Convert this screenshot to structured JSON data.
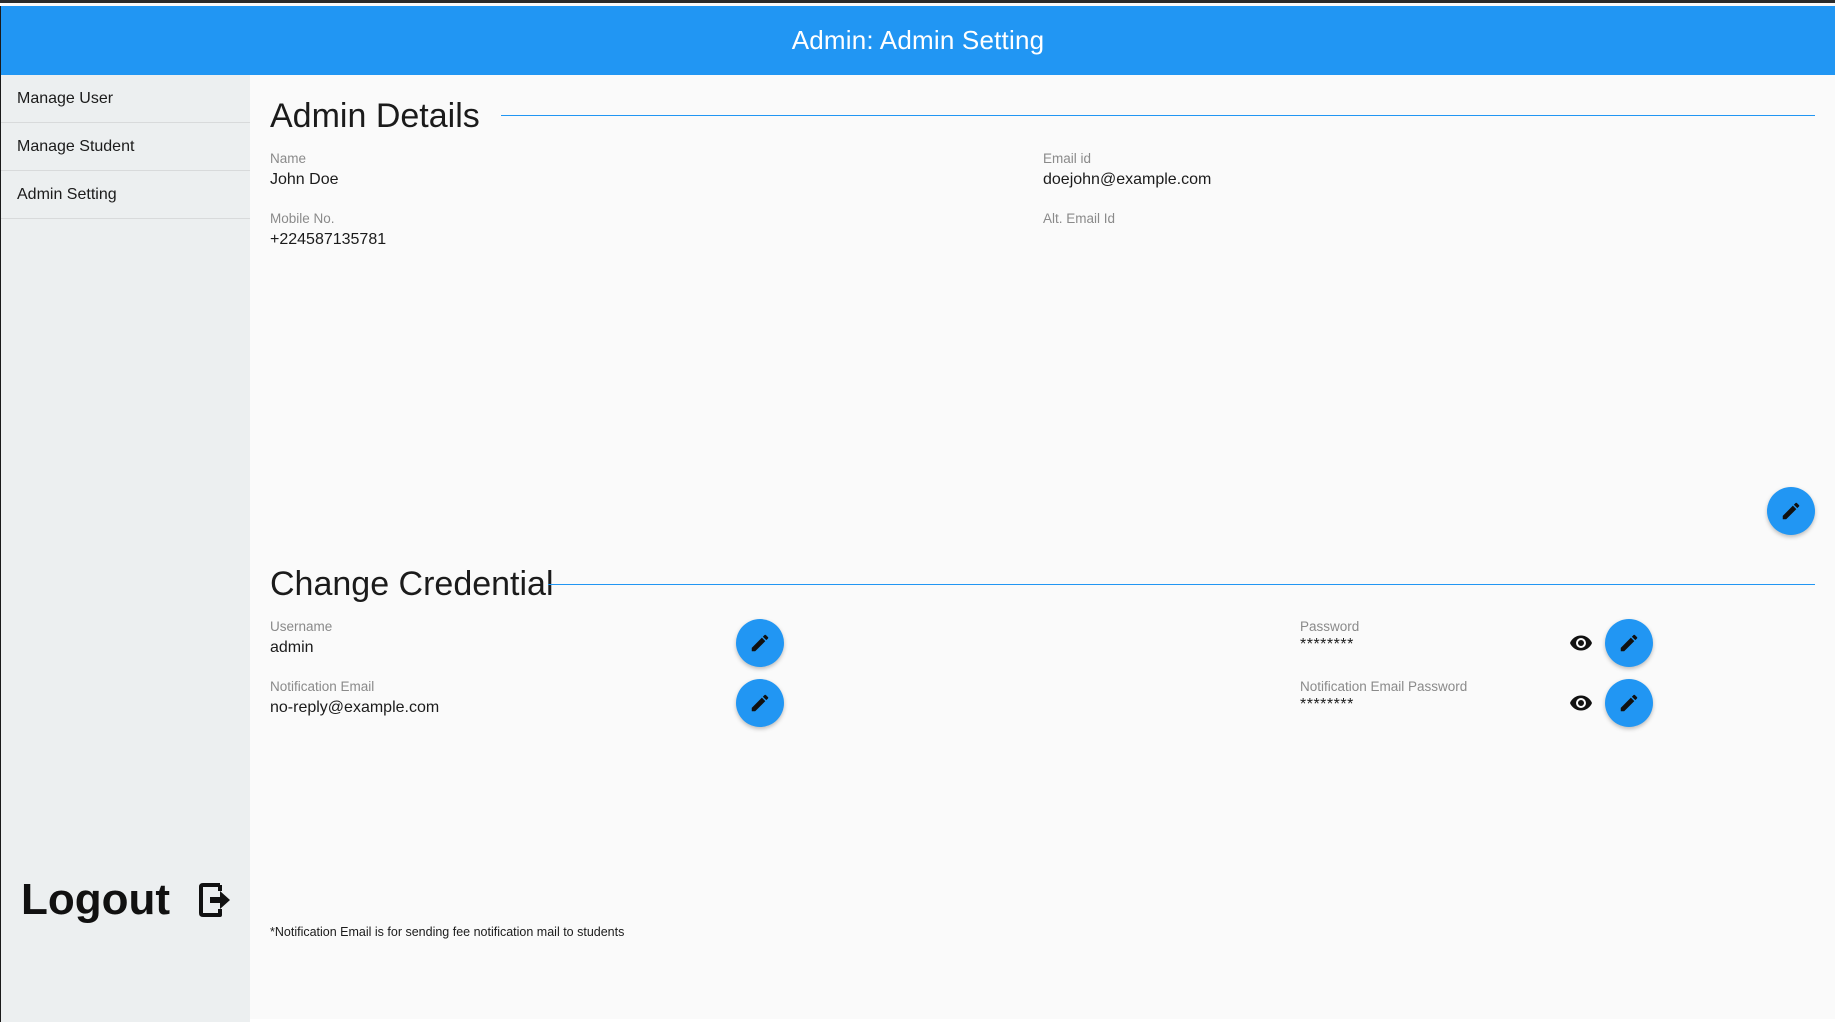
{
  "header": {
    "title": "Admin: Admin Setting"
  },
  "sidebar": {
    "items": [
      {
        "label": "Manage User"
      },
      {
        "label": "Manage Student"
      },
      {
        "label": "Admin Setting"
      }
    ],
    "logout_label": "Logout"
  },
  "admin_details": {
    "title": "Admin Details",
    "name_label": "Name",
    "name_value": "John Doe",
    "email_label": "Email id",
    "email_value": "doejohn@example.com",
    "mobile_label": "Mobile No.",
    "mobile_value": "+224587135781",
    "alt_email_label": "Alt. Email Id",
    "alt_email_value": ""
  },
  "credentials": {
    "title": "Change Credential",
    "username_label": "Username",
    "username_value": "admin",
    "password_label": "Password",
    "password_value": "********",
    "notif_email_label": "Notification Email",
    "notif_email_value": "no-reply@example.com",
    "notif_password_label": "Notification Email Password",
    "notif_password_value": "********"
  },
  "footnote": "*Notification Email is for sending fee notification mail to students",
  "colors": {
    "primary": "#2196f3",
    "sidebar_bg": "#eceff0",
    "page_bg": "#fafafa"
  },
  "icons": [
    "edit-icon",
    "eye-icon",
    "logout-icon"
  ]
}
